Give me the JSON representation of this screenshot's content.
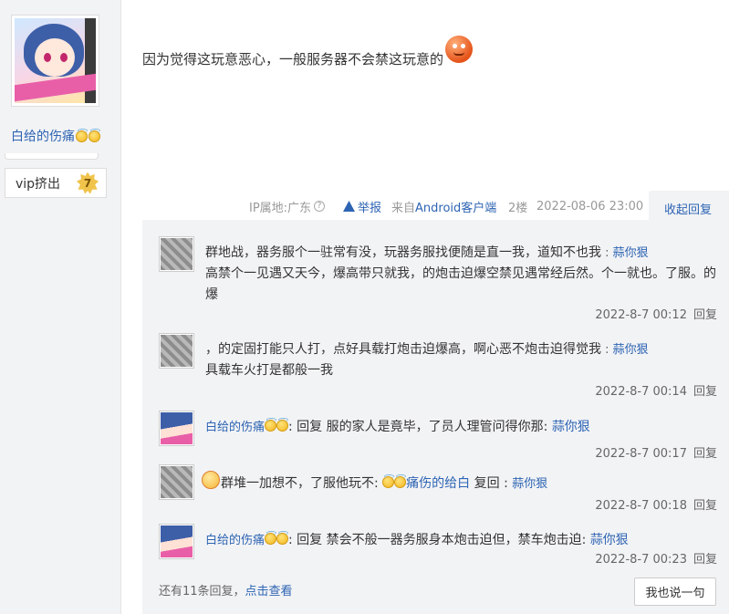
{
  "user": {
    "name": "白给的伤痛",
    "badge_icon": "emoji-halo-icon",
    "vip_label": "vip挤出",
    "level": "7"
  },
  "post": {
    "text": "因为觉得这玩意恶心，一般服务器不会禁这玩意的",
    "emoji_icon": "emoji-laugh-icon",
    "meta": {
      "ip": "IP属地:广东",
      "help": "?",
      "report": "举报",
      "source_prefix": "来自",
      "source": "Android客户端",
      "floor": "2楼",
      "time": "2022-08-06 23:00",
      "collapse": "收起回复"
    }
  },
  "replies": [
    {
      "avatar": "gray-avatar",
      "text": "群地战，器务服个一驻常有没，玩器务服找便随是直一我，道知不也我",
      "sep": " : ",
      "author": "蒜你狠",
      "text2": "高禁个一见遇又天今，爆高带只就我，的炮击迫爆空禁见遇常经后然。个一就也。了服。的爆",
      "time": "2022-8-7 00:12",
      "reply_label": "回复"
    },
    {
      "avatar": "gray-avatar",
      "text": "，的定固打能只人打，点好具载打炮击迫爆高，啊心恶不炮击迫得觉我",
      "sep": " : ",
      "author": "蒜你狠",
      "text2": "具载车火打是都般一我",
      "time": "2022-8-7 00:14",
      "reply_label": "回复"
    },
    {
      "avatar": "anime-avatar",
      "author": "白给的伤痛",
      "text": ": 回复 服的家人是竟毕，了员人理管问得你那:",
      "target": "蒜你狠",
      "time": "2022-8-7 00:17",
      "reply_label": "回复"
    },
    {
      "avatar": "gray-avatar",
      "text": "群堆一加想不，了服他玩不:",
      "mention": "痛伤的给白",
      "text2": "复回 :",
      "author": "蒜你狠",
      "time": "2022-8-7 00:18",
      "reply_label": "回复"
    },
    {
      "avatar": "anime-avatar",
      "author": "白给的伤痛",
      "text": ": 回复 禁会不般一器务服身本炮击迫但，禁车炮击迫:",
      "target": "蒜你狠",
      "time": "2022-8-7 00:23",
      "reply_label": "回复"
    }
  ],
  "more": {
    "text": "还有11条回复，",
    "link": "点击查看"
  },
  "say_button": "我也说一句"
}
